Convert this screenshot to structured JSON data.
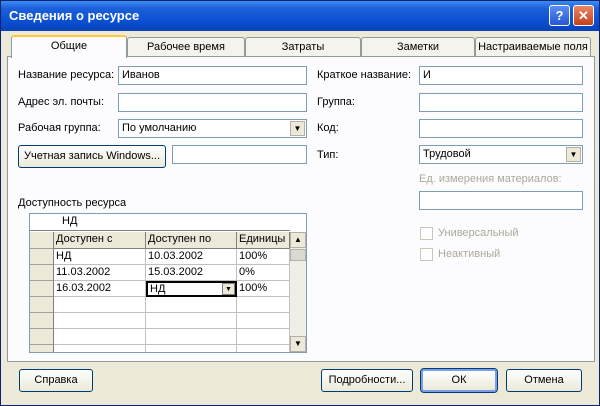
{
  "window": {
    "title": "Сведения о ресурсе",
    "help_glyph": "?",
    "close_glyph": "✕"
  },
  "tabs": [
    "Общие",
    "Рабочее время",
    "Затраты",
    "Заметки",
    "Настраиваемые поля"
  ],
  "active_tab": "Общие",
  "form": {
    "name_label": "Название ресурса:",
    "name_value": "Иванов",
    "email_label": "Адрес эл. почты:",
    "email_value": "",
    "workgroup_label": "Рабочая группа:",
    "workgroup_value": "По умолчанию",
    "windows_account_button": "Учетная запись Windows...",
    "windows_account_value": "",
    "short_name_label": "Краткое название:",
    "short_name_value": "И",
    "group_label": "Группа:",
    "group_value": "",
    "code_label": "Код:",
    "code_value": "",
    "type_label": "Тип:",
    "type_value": "Трудовой",
    "material_unit_label": "Ед. измерения материалов:",
    "material_unit_value": "",
    "generic_label": "Универсальный",
    "inactive_label": "Неактивный"
  },
  "availability": {
    "label": "Доступность ресурса",
    "edit_value": "НД",
    "columns": [
      "Доступен с",
      "Доступен по",
      "Единицы"
    ],
    "rows": [
      [
        "НД",
        "10.03.2002",
        "100%"
      ],
      [
        "11.03.2002",
        "15.03.2002",
        "0%"
      ],
      [
        "16.03.2002",
        "НД",
        "100%"
      ]
    ]
  },
  "buttons": {
    "help": "Справка",
    "details": "Подробности...",
    "ok": "ОК",
    "cancel": "Отмена"
  },
  "icons": {
    "dropdown": "chevron-down-icon",
    "scroll_up": "arrow-up-icon",
    "scroll_down": "arrow-down-icon"
  }
}
